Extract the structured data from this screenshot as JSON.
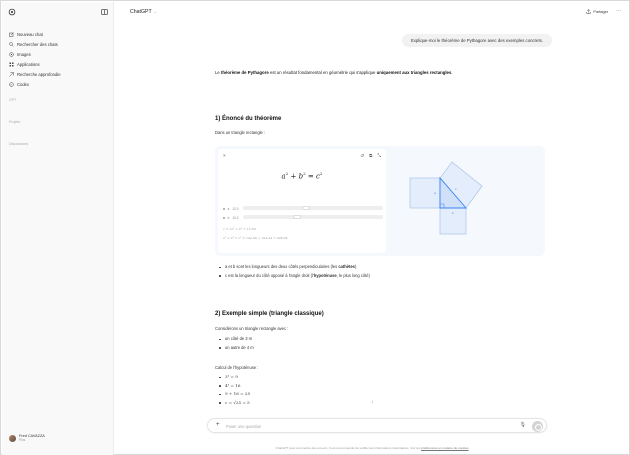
{
  "sidebar": {
    "items": [
      {
        "label": "Nouveau chat",
        "icon": "new-chat-icon"
      },
      {
        "label": "Rechercher des chats",
        "icon": "search-icon"
      },
      {
        "label": "Images",
        "icon": "image-icon"
      },
      {
        "label": "Applications",
        "icon": "apps-icon"
      },
      {
        "label": "Recherche approfondie",
        "icon": "deep-research-icon"
      },
      {
        "label": "Codex",
        "icon": "codex-icon"
      }
    ],
    "sections": [
      "GPT",
      "Projets",
      "Discussions"
    ],
    "user": {
      "name": "Fred CAVAZZA",
      "plan": "Plus"
    }
  },
  "header": {
    "model": "ChatGPT",
    "share": "Partager"
  },
  "conversation": {
    "user_message": "Explique-moi le théorème de Pythagore avec des exemples concrets.",
    "intro": {
      "p1": "Le ",
      "b1": "théorème de Pythagore",
      "p2": " est un résultat fondamental en géométrie qui s'applique ",
      "b2": "uniquement aux triangles rectangles",
      "p3": "."
    },
    "section1_title": "1) Énoncé du théorème",
    "section1_intro": "Dans un triangle rectangle :",
    "widget": {
      "formula_a": "a",
      "formula_b": "b",
      "formula_c": "c",
      "exp": "2",
      "slider1_label": "a",
      "slider1_value": "12.0",
      "slider1_fraction": 0.45,
      "slider2_label": "b",
      "slider2_value": "10.2",
      "slider2_fraction": 0.38,
      "calc1": "c = √a² + b² = 15.69",
      "calc2": "a² + b² = c² ⇒ 144.00 + 104.04 = 248.04"
    },
    "bullets1": [
      {
        "text": "a et b sont les longueurs des deux côtés perpendiculaires (les ",
        "bold": "cathètes",
        "tail": ")"
      },
      {
        "text": "c est la longueur du côté opposé à l'angle droit (l'",
        "bold": "hypoténuse",
        "tail": ", le plus long côté)"
      }
    ],
    "section2_title": "2) Exemple simple (triangle classique)",
    "section2_intro": "Considérons un triangle rectangle avec :",
    "bullets2": [
      "un côté de 3 m",
      "un autre de 4 m"
    ],
    "calc_title": "Calcul de l'hypoténuse :",
    "calc_steps": [
      "3² = 9",
      "4² = 16",
      "9 + 16 = 25",
      "c = √25 = 5"
    ]
  },
  "composer": {
    "placeholder": "Poser une question",
    "disclaimer": "ChatGPT peut commettre des erreurs. Il est recommandé de vérifier les informations importantes. Voir les ",
    "disclaimer_link": "préférences en matière de cookies",
    "disclaimer_end": "."
  },
  "colors": {
    "accent_blue": "#3b82f6",
    "figure_fill": "#dbeafe"
  }
}
